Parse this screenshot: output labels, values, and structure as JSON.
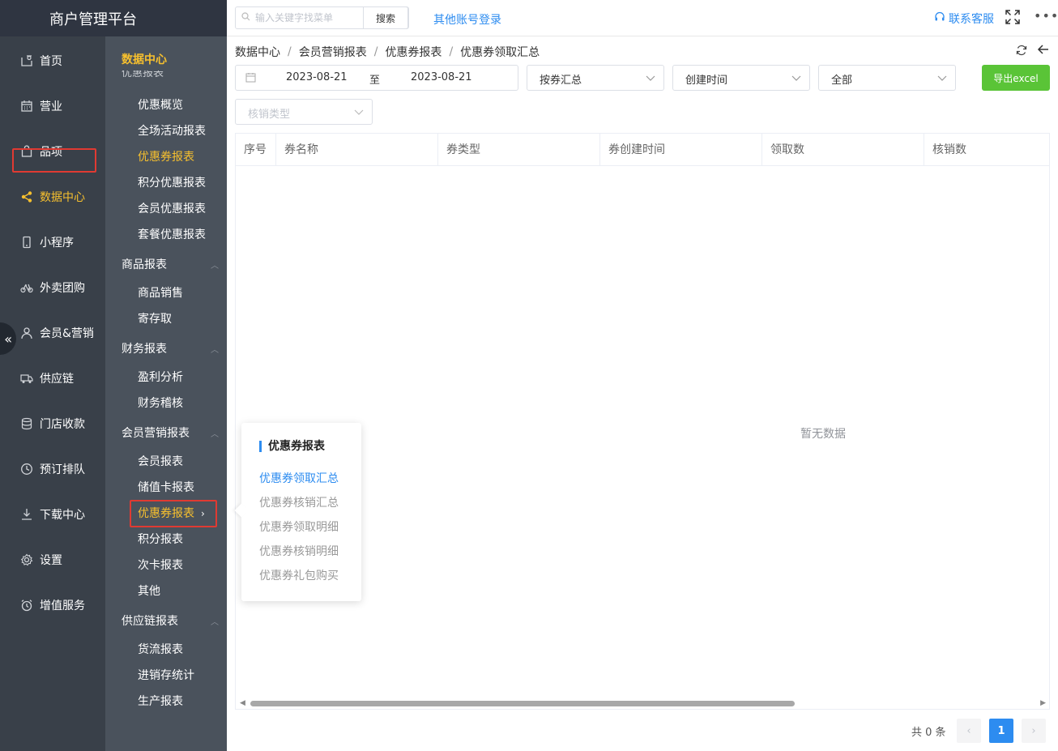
{
  "app": {
    "title": "商户管理平台"
  },
  "topbar": {
    "search_placeholder": "输入关键字找菜单",
    "search_button": "搜索",
    "other_login": "其他账号登录",
    "service": "联系客服",
    "more": "•••"
  },
  "mainnav": [
    {
      "label": "首页",
      "icon": "home-icon"
    },
    {
      "label": "营业",
      "icon": "calendar-icon"
    },
    {
      "label": "品项",
      "icon": "bag-icon"
    },
    {
      "label": "数据中心",
      "icon": "share-icon",
      "active": true
    },
    {
      "label": "小程序",
      "icon": "phone-icon"
    },
    {
      "label": "外卖团购",
      "icon": "bike-icon"
    },
    {
      "label": "会员&营销",
      "icon": "user-icon"
    },
    {
      "label": "供应链",
      "icon": "truck-icon"
    },
    {
      "label": "门店收款",
      "icon": "database-icon"
    },
    {
      "label": "预订排队",
      "icon": "clock-icon"
    },
    {
      "label": "下载中心",
      "icon": "download-icon"
    },
    {
      "label": "设置",
      "icon": "gear-icon"
    },
    {
      "label": "增值服务",
      "icon": "alarm-icon"
    }
  ],
  "subnav": {
    "title": "数据中心",
    "cut_label": "优惠报表",
    "items_top": [
      "优惠概览",
      "全场活动报表",
      "优惠券报表",
      "积分优惠报表",
      "会员优惠报表",
      "套餐优惠报表"
    ],
    "groups": [
      {
        "label": "商品报表",
        "items": [
          "商品销售",
          "寄存取"
        ]
      },
      {
        "label": "财务报表",
        "items": [
          "盈利分析",
          "财务稽核"
        ]
      },
      {
        "label": "会员营销报表",
        "items": [
          "会员报表",
          "储值卡报表",
          "优惠券报表",
          "积分报表",
          "次卡报表",
          "其他"
        ]
      },
      {
        "label": "供应链报表",
        "items": [
          "货流报表",
          "进销存统计",
          "生产报表"
        ]
      }
    ]
  },
  "breadcrumb": [
    "数据中心",
    "会员营销报表",
    "优惠券报表",
    "优惠券领取汇总"
  ],
  "filters": {
    "date_start": "2023-08-21",
    "date_to": "至",
    "date_end": "2023-08-21",
    "group_by": "按券汇总",
    "time_type": "创建时间",
    "status": "全部",
    "verify_type_placeholder": "核销类型",
    "export": "导出excel"
  },
  "table": {
    "columns": [
      "序号",
      "券名称",
      "券类型",
      "券创建时间",
      "领取数",
      "核销数"
    ],
    "empty_text": "暂无数据"
  },
  "pagination": {
    "total_text": "共 0 条",
    "current": "1",
    "prev": "‹",
    "next": "›"
  },
  "popover": {
    "title": "优惠券报表",
    "items": [
      "优惠券领取汇总",
      "优惠券核销汇总",
      "优惠券领取明细",
      "优惠券核销明细",
      "优惠券礼包购买"
    ],
    "active_index": 0
  },
  "colors": {
    "accent": "#2d8cf0",
    "nav_active": "#f7c02e",
    "export": "#5ac437",
    "highlight_box": "#e03a32"
  }
}
